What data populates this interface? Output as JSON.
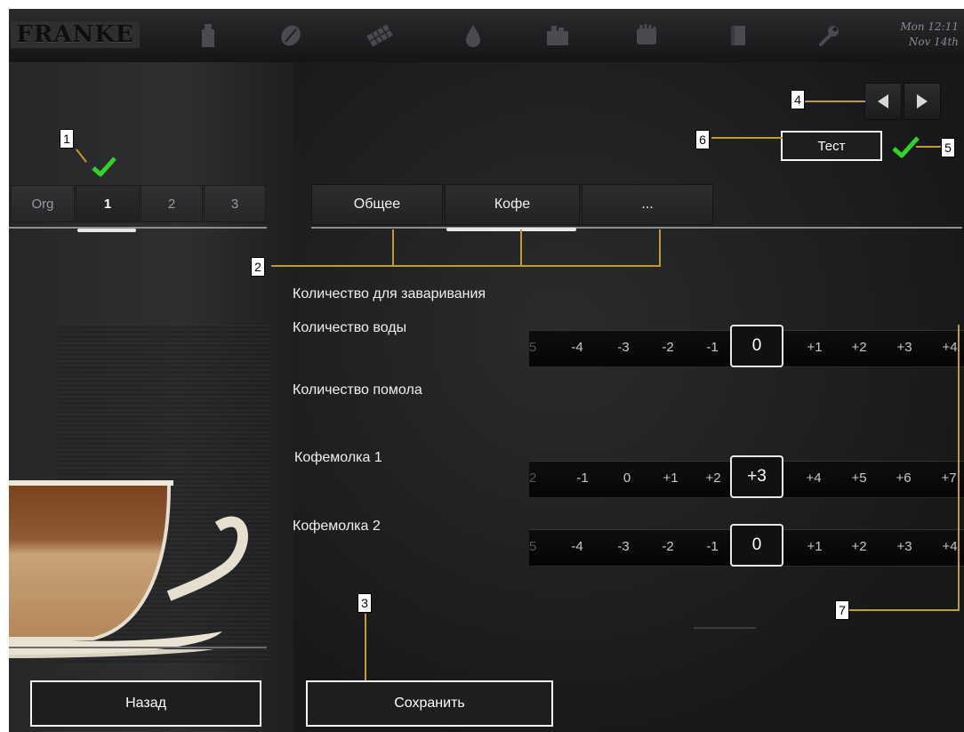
{
  "header": {
    "logo": "FRANKE",
    "date_line1": "Mon 12:11",
    "date_line2": "Nov 14th",
    "icons": [
      "product-icon",
      "coffee-bean-icon",
      "chocolate-bar-icon",
      "water-drop-icon",
      "cleaning-icon",
      "hand-icon",
      "door-icon",
      "wrench-icon"
    ]
  },
  "product_tabs": [
    {
      "label": "Org",
      "active": false
    },
    {
      "label": "1",
      "active": true
    },
    {
      "label": "2",
      "active": false
    },
    {
      "label": "3",
      "active": false
    }
  ],
  "category_tabs": [
    {
      "label": "Общее",
      "active": false
    },
    {
      "label": "Кофе",
      "active": true
    },
    {
      "label": "...",
      "active": false
    }
  ],
  "test_button": "Тест",
  "sections": {
    "brew_quantity": "Количество для заваривания",
    "water_quantity": "Количество воды",
    "grind_quantity": "Количество помола",
    "grinder1": "Кофемолка 1",
    "grinder2": "Кофемолка 2"
  },
  "scales": {
    "water": {
      "values": [
        "5",
        "-4",
        "-3",
        "-2",
        "-1",
        "0",
        "+1",
        "+2",
        "+3",
        "+4"
      ],
      "selected": "0"
    },
    "grinder1": {
      "values": [
        "2",
        "-1",
        "0",
        "+1",
        "+2",
        "+3",
        "+4",
        "+5",
        "+6",
        "+7"
      ],
      "selected": "+3"
    },
    "grinder2": {
      "values": [
        "5",
        "-4",
        "-3",
        "-2",
        "-1",
        "0",
        "+1",
        "+2",
        "+3",
        "+4"
      ],
      "selected": "0"
    }
  },
  "buttons": {
    "back": "Назад",
    "save": "Сохранить"
  },
  "callouts": [
    "1",
    "2",
    "3",
    "4",
    "5",
    "6",
    "7"
  ],
  "colors": {
    "accent_check": "#34d12b",
    "callout_line": "#c49a33"
  }
}
